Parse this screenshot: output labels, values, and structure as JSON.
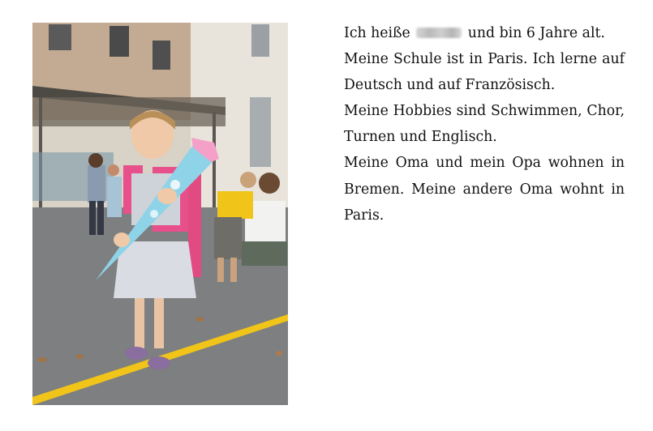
{
  "text": {
    "line1_before": "Ich heiße",
    "line1_after": "und bin 6 Jahre alt.",
    "p2": "Meine Schule ist in Paris. Ich lerne auf Deutsch und auf Französisch.",
    "p3": "Meine Hobbies sind Schwimmen, Chor, Turnen und Englisch.",
    "p4": "Meine Oma und mein Opa wohnen in Bremen. Meine andere Oma wohnt in Paris."
  },
  "colors": {
    "schultuete": "#8fd3e8",
    "schultuete_top": "#f4a0c8",
    "ground": "#7d7f80",
    "building": "#c8b9a6",
    "line": "#f0c419"
  }
}
